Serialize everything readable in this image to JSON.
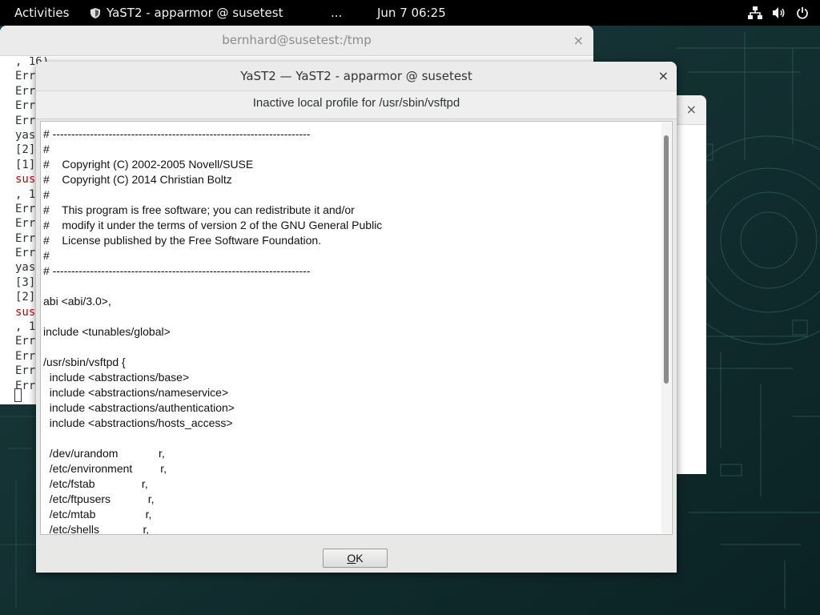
{
  "topbar": {
    "activities": "Activities",
    "app_title": "YaST2 - apparmor @ susetest",
    "overflow": "...",
    "clock": "Jun 7  06:25",
    "icons": [
      "network-icon",
      "volume-icon",
      "power-icon"
    ]
  },
  "terminal": {
    "title": "bernhard@susetest:/tmp",
    "close": "×",
    "lines": [
      {
        "text": ", 16)",
        "red": false
      },
      {
        "text": "Err",
        "red": false
      },
      {
        "text": "Err",
        "red": false
      },
      {
        "text": "Err",
        "red": false
      },
      {
        "text": "Err",
        "red": false
      },
      {
        "text": "yas",
        "red": false
      },
      {
        "text": "[2]",
        "red": false
      },
      {
        "text": "[1]",
        "red": false
      },
      {
        "text": "sus",
        "red": true
      },
      {
        "text": ", 1",
        "red": false
      },
      {
        "text": "Err",
        "red": false
      },
      {
        "text": "Err",
        "red": false
      },
      {
        "text": "Err",
        "red": false
      },
      {
        "text": "Err",
        "red": false
      },
      {
        "text": "yas",
        "red": false
      },
      {
        "text": "[3]",
        "red": false
      },
      {
        "text": "[2]",
        "red": false
      },
      {
        "text": "sus",
        "red": true
      },
      {
        "text": ", 1",
        "red": false
      },
      {
        "text": "Err",
        "red": false
      },
      {
        "text": "Err",
        "red": false
      },
      {
        "text": "Err",
        "red": false
      },
      {
        "text": "Err",
        "red": false
      }
    ]
  },
  "background_dialog": {
    "close": "×"
  },
  "dialog": {
    "title": "YaST2 — YaST2 - apparmor @ susetest",
    "close": "×",
    "heading": "Inactive local profile for /usr/sbin/vsftpd",
    "lines": [
      "# ---------------------------------------------------------------------",
      "#",
      "#    Copyright (C) 2002-2005 Novell/SUSE",
      "#    Copyright (C) 2014 Christian Boltz",
      "#",
      "#    This program is free software; you can redistribute it and/or",
      "#    modify it under the terms of version 2 of the GNU General Public",
      "#    License published by the Free Software Foundation.",
      "#",
      "# ---------------------------------------------------------------------",
      "",
      "abi <abi/3.0>,",
      "",
      "include <tunables/global>",
      "",
      "/usr/sbin/vsftpd {",
      "  include <abstractions/base>",
      "  include <abstractions/nameservice>",
      "  include <abstractions/authentication>",
      "  include <abstractions/hosts_access>",
      "",
      "  /dev/urandom             r,",
      "  /etc/environment         r,",
      "  /etc/fstab               r,",
      "  /etc/ftpusers            r,",
      "  /etc/mtab                r,",
      "  /etc/shells              r,"
    ],
    "ok_mnemonic": "O",
    "ok_rest": "K"
  },
  "colors": {
    "topbar": "#000000",
    "desktop": "#0d2a2c",
    "terminal_error": "#cc0000",
    "dialog_bg": "#e8e8e7"
  }
}
